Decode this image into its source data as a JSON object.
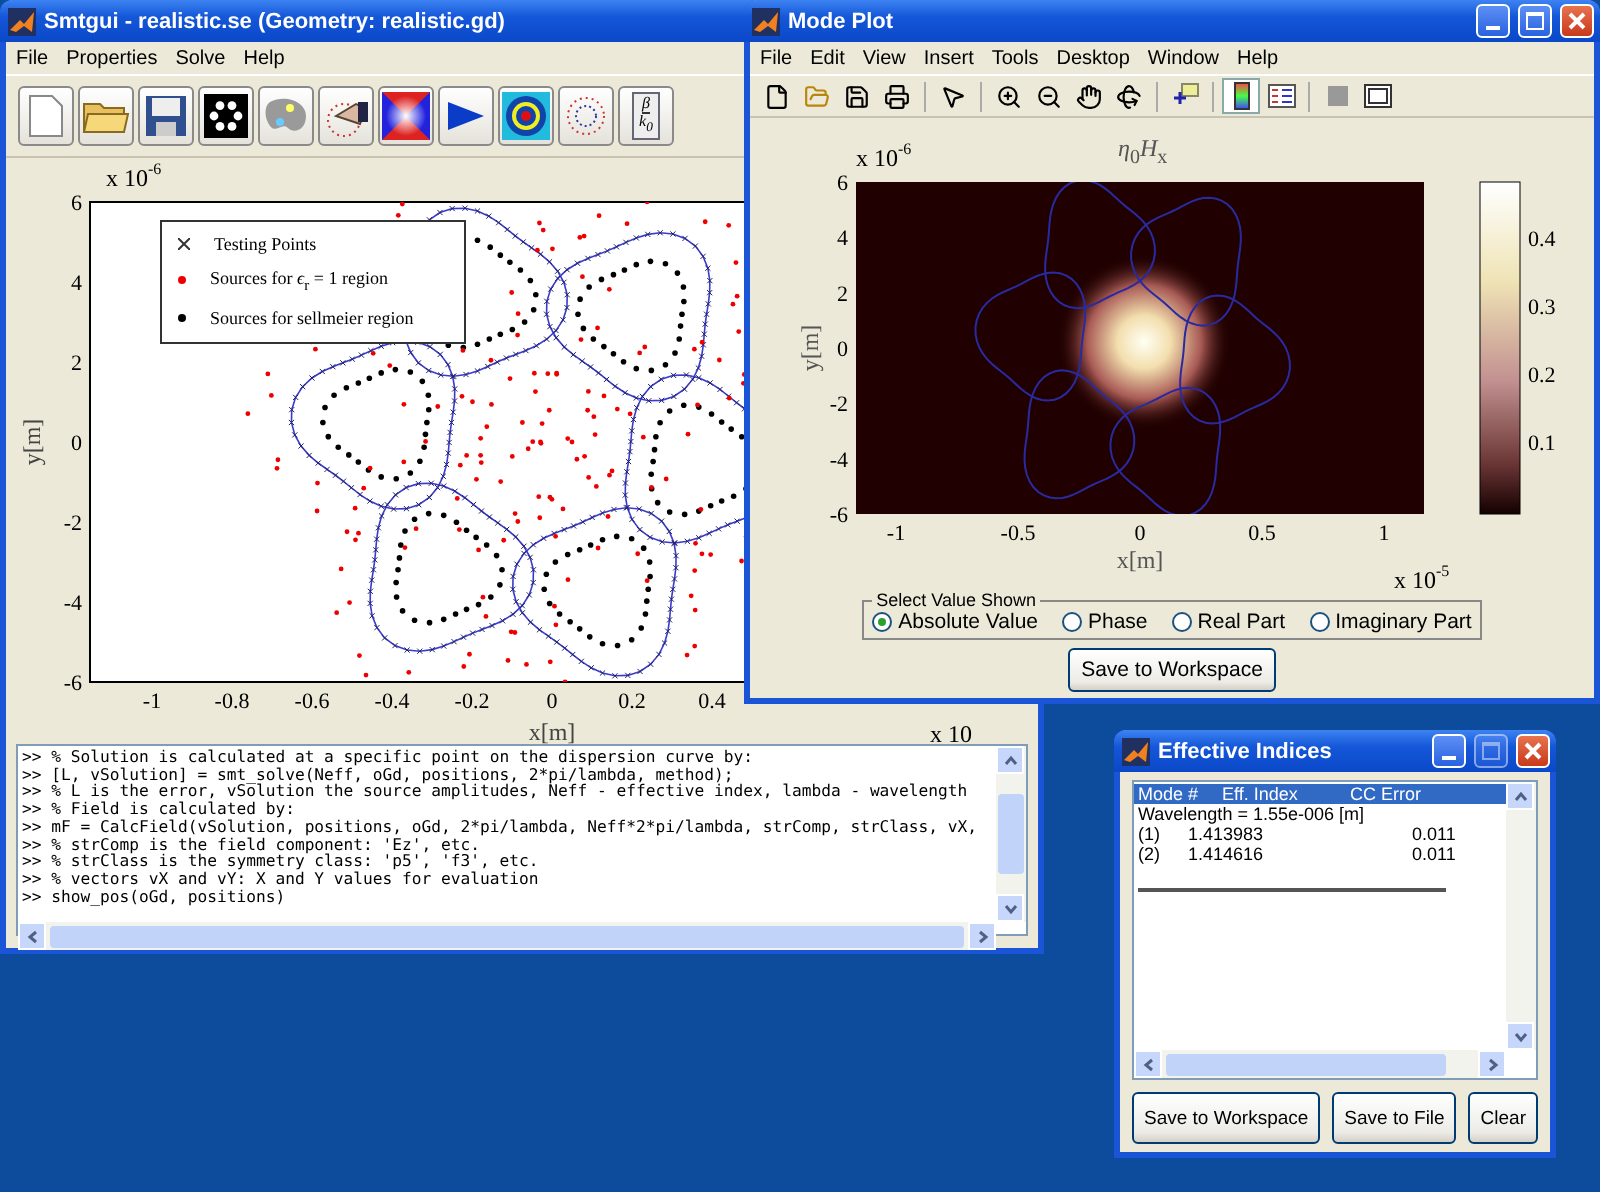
{
  "smtgui": {
    "title": "Smtgui - realistic.se (Geometry: realistic.gd)",
    "menu": [
      "File",
      "Properties",
      "Solve",
      "Help"
    ],
    "toolbar_formula": {
      "numerator": "β",
      "denominator": "*k*$_{0}$"
    },
    "plot": {
      "y_exponent": {
        "base": "x 10",
        "power": "-6"
      },
      "x_exponent": {
        "base": "x 10"
      },
      "xlabel": "x[m]",
      "ylabel": "y[m]",
      "xticks": [
        "-1",
        "-0.8",
        "-0.6",
        "-0.4",
        "-0.2",
        "0",
        "0.2",
        "0.4"
      ],
      "yticks": [
        "6",
        "4",
        "2",
        "0",
        "-2",
        "-4",
        "-6"
      ],
      "legend": [
        {
          "kind": "cross",
          "label": "Testing Points"
        },
        {
          "kind": "red",
          "label": "Sources for *ϵ*$_{r}$ = 1 region"
        },
        {
          "kind": "black",
          "label": "Sources for sellmeier region"
        }
      ]
    },
    "console": [
      ">> % Solution is calculated at a specific point on the dispersion curve by:",
      ">> [L, vSolution] = smt_solve(Neff, oGd, positions, 2*pi/lambda, method);",
      ">> % L is the error, vSolution the source amplitudes, Neff - effective index, lambda - wavelength",
      ">> % Field is calculated by:",
      ">> mF = CalcField(vSolution, positions, oGd, 2*pi/lambda, Neff*2*pi/lambda, strComp, strClass, vX,",
      ">> % strComp is the field component: 'Ez', etc.",
      ">> % strClass is the symmetry class: 'p5', 'f3', etc.",
      ">> % vectors vX and vY: X and Y values for evaluation",
      ">> show_pos(oGd, positions)"
    ]
  },
  "mode_plot": {
    "title": "Mode Plot",
    "menu": [
      "File",
      "Edit",
      "View",
      "Insert",
      "Tools",
      "Desktop",
      "Window",
      "Help"
    ],
    "plot_title": "*η*$_{0}$*H*$_{x}$",
    "y_exponent": {
      "base": "x 10",
      "power": "-6"
    },
    "x_exponent": {
      "base": "x 10",
      "power": "-5"
    },
    "xlabel": "x[m]",
    "ylabel": "y[m]",
    "xticks": [
      "-1",
      "-0.5",
      "0",
      "0.5",
      "1"
    ],
    "yticks": [
      "6",
      "4",
      "2",
      "0",
      "-2",
      "-4",
      "-6"
    ],
    "colorbar_ticks": [
      "0.4",
      "0.3",
      "0.2",
      "0.1"
    ],
    "value_select": {
      "legend": "Select Value Shown",
      "options": [
        {
          "label": "Absolute Value",
          "selected": true
        },
        {
          "label": "Phase",
          "selected": false
        },
        {
          "label": "Real Part",
          "selected": false
        },
        {
          "label": "Imaginary Part",
          "selected": false
        }
      ]
    },
    "button": "Save to Workspace"
  },
  "effective_indices": {
    "title": "Effective Indices",
    "rows": [
      {
        "kind": "header",
        "cells": [
          "Mode #",
          "Eff. Index",
          "CC Error"
        ],
        "selected": true
      },
      {
        "kind": "info",
        "cells": [
          "Wavelength = 1.55e-006 [m]"
        ],
        "selected": false
      },
      {
        "kind": "mode",
        "cells": [
          "(1)",
          "1.413983",
          "0.011"
        ],
        "selected": false
      },
      {
        "kind": "mode",
        "cells": [
          "(2)",
          "1.414616",
          "0.011"
        ],
        "selected": false
      }
    ],
    "buttons": [
      "Save to Workspace",
      "Save to File",
      "Clear"
    ]
  }
}
